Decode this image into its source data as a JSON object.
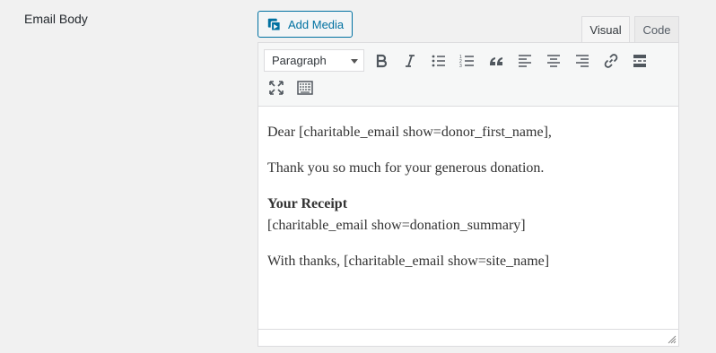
{
  "field": {
    "label": "Email Body"
  },
  "media": {
    "add_media_label": "Add Media"
  },
  "tabs": {
    "visual": "Visual",
    "code": "Code"
  },
  "toolbar": {
    "format_select_value": "Paragraph",
    "buttons": [
      "bold-icon",
      "italic-icon",
      "bullet-list-icon",
      "numbered-list-icon",
      "blockquote-icon",
      "align-left-icon",
      "align-center-icon",
      "align-right-icon",
      "link-icon",
      "read-more-icon",
      "fullscreen-icon",
      "toolbar-toggle-icon"
    ]
  },
  "content": {
    "p1": "Dear [charitable_email show=donor_first_name],",
    "p2": "Thank you so much for your generous donation.",
    "receipt_heading": "Your Receipt",
    "receipt_shortcode": "[charitable_email show=donation_summary]",
    "p4": "With thanks, [charitable_email show=site_name]"
  },
  "colors": {
    "accent": "#0071a1",
    "text": "#23282d",
    "border": "#dcdcde"
  }
}
